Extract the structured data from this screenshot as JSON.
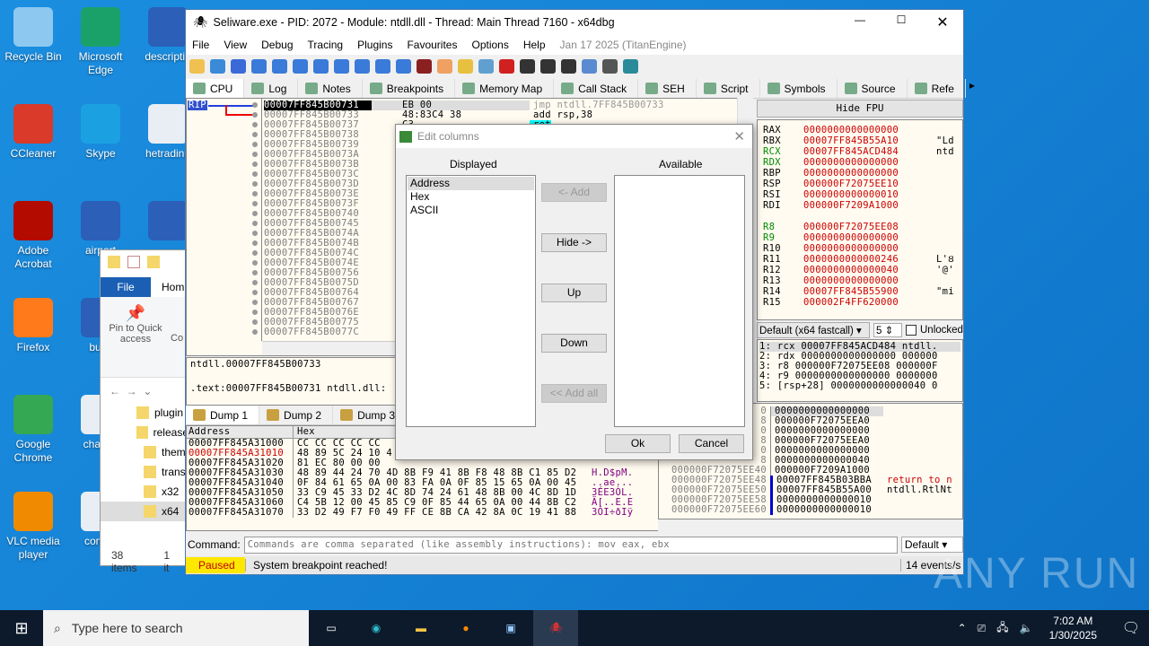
{
  "desktop": {
    "icons": [
      {
        "label": "Recycle Bin",
        "icon": "recycle-bin-icon",
        "color": "#8cc8f0"
      },
      {
        "label": "Microsoft Edge",
        "icon": "edge-icon",
        "color": "#1aa16a"
      },
      {
        "label": "descriptio",
        "icon": "word-doc-icon",
        "color": "#2b5fb8"
      },
      {
        "label": "CCleaner",
        "icon": "ccleaner-icon",
        "color": "#d93a2a"
      },
      {
        "label": "Skype",
        "icon": "skype-icon",
        "color": "#1ba1e2"
      },
      {
        "label": "hetrading",
        "icon": "image-file-icon",
        "color": "#e8eef4"
      },
      {
        "label": "Adobe Acrobat",
        "icon": "acrobat-icon",
        "color": "#b30b00"
      },
      {
        "label": "airport",
        "icon": "word-doc-icon",
        "color": "#2b5fb8"
      },
      {
        "label": "",
        "icon": "word-doc-icon",
        "color": "#2b5fb8"
      },
      {
        "label": "Firefox",
        "icon": "firefox-icon",
        "color": "#ff7a1a"
      },
      {
        "label": "build",
        "icon": "word-doc-icon",
        "color": "#2b5fb8"
      },
      {
        "label": "Google Chrome",
        "icon": "chrome-icon",
        "color": "#34a853"
      },
      {
        "label": "chance",
        "icon": "image-file-icon",
        "color": "#e8eef4"
      },
      {
        "label": "VLC media player",
        "icon": "vlc-icon",
        "color": "#f08a00"
      },
      {
        "label": "comep",
        "icon": "image-file-icon",
        "color": "#e8eef4"
      }
    ]
  },
  "explorer": {
    "file_tab": "File",
    "home_tab": "Hom",
    "pin_label": "Pin to Quick access",
    "copy_label": "Co",
    "folders": [
      "plugin",
      "release",
      "them",
      "trans",
      "x32",
      "x64"
    ],
    "status_items": "38 items",
    "status_sel": "1 it"
  },
  "debugger": {
    "title": "Seliware.exe - PID: 2072 - Module: ntdll.dll - Thread: Main Thread 7160 - x64dbg",
    "menu": [
      "File",
      "View",
      "Debug",
      "Tracing",
      "Plugins",
      "Favourites",
      "Options",
      "Help"
    ],
    "build": "Jan 17 2025 (TitanEngine)",
    "tabs": [
      "CPU",
      "Log",
      "Notes",
      "Breakpoints",
      "Memory Map",
      "Call Stack",
      "SEH",
      "Script",
      "Symbols",
      "Source",
      "Refe"
    ],
    "rip_label": "RIP",
    "disasm_addresses": [
      "00007FF845B00731",
      "00007FF845B00733",
      "00007FF845B00737",
      "00007FF845B00738",
      "00007FF845B00739",
      "00007FF845B0073A",
      "00007FF845B0073B",
      "00007FF845B0073C",
      "00007FF845B0073D",
      "00007FF845B0073E",
      "00007FF845B0073F",
      "00007FF845B00740",
      "00007FF845B00745",
      "00007FF845B0074A",
      "00007FF845B0074B",
      "00007FF845B0074C",
      "00007FF845B0074E",
      "00007FF845B00756",
      "00007FF845B0075D",
      "00007FF845B00764",
      "00007FF845B00767",
      "00007FF845B0076E",
      "00007FF845B00775",
      "00007FF845B0077C"
    ],
    "disasm_bytes": [
      "EB 00",
      "48:83C4 38",
      "C3"
    ],
    "disasm_instr": [
      "jmp ntdll.7FF845B00733",
      "add rsp,38",
      "ret"
    ],
    "info_line1": "ntdll.00007FF845B00733",
    "info_line2": ".text:00007FF845B00731 ntdll.dll:",
    "hide_fpu": "Hide FPU",
    "registers": [
      {
        "name": "RAX",
        "value": "0000000000000000",
        "comment": "",
        "green": false
      },
      {
        "name": "RBX",
        "value": "00007FF845B55A10",
        "comment": "\"Ld",
        "green": false
      },
      {
        "name": "RCX",
        "value": "00007FF845ACD484",
        "comment": "ntd",
        "green": true
      },
      {
        "name": "RDX",
        "value": "0000000000000000",
        "comment": "",
        "green": true
      },
      {
        "name": "RBP",
        "value": "0000000000000000",
        "comment": "",
        "green": false
      },
      {
        "name": "RSP",
        "value": "000000F72075EE10",
        "comment": "",
        "green": false
      },
      {
        "name": "RSI",
        "value": "0000000000000010",
        "comment": "",
        "green": false
      },
      {
        "name": "RDI",
        "value": "000000F7209A1000",
        "comment": "",
        "green": false
      },
      {
        "name": "",
        "value": "",
        "comment": "",
        "green": false
      },
      {
        "name": "R8",
        "value": "000000F72075EE08",
        "comment": "",
        "green": true
      },
      {
        "name": "R9",
        "value": "0000000000000000",
        "comment": "",
        "green": true
      },
      {
        "name": "R10",
        "value": "0000000000000000",
        "comment": "",
        "green": false
      },
      {
        "name": "R11",
        "value": "0000000000000246",
        "comment": "L'Ȣ",
        "green": false
      },
      {
        "name": "R12",
        "value": "0000000000000040",
        "comment": "'@'",
        "green": false
      },
      {
        "name": "R13",
        "value": "0000000000000000",
        "comment": "",
        "green": false
      },
      {
        "name": "R14",
        "value": "00007FF845B55900",
        "comment": "\"mi",
        "green": false
      },
      {
        "name": "R15",
        "value": "000002F4FF620000",
        "comment": "",
        "green": false
      }
    ],
    "callconv": "Default (x64 fastcall)",
    "argcount": "5",
    "unlocked": "Unlocked",
    "args": [
      "1: rcx 00007FF845ACD484 ntdll.",
      "2: rdx 0000000000000000 000000",
      "3: r8 000000F72075EE08 000000F",
      "4: r9 0000000000000000 0000000",
      "5: [rsp+28] 0000000000000040 0"
    ],
    "dump_tabs": [
      "Dump 1",
      "Dump 2",
      "Dump 3"
    ],
    "dump_headers": [
      "Address",
      "Hex"
    ],
    "dump_rows": [
      {
        "addr": "00007FF845A31000",
        "hex": "CC CC CC CC CC",
        "ascii": ""
      },
      {
        "addr": "00007FF845A31010",
        "hex": "48 89 5C 24 10 4",
        "ascii": ""
      },
      {
        "addr": "00007FF845A31020",
        "hex": "81 EC 80 00 00",
        "ascii": ""
      },
      {
        "addr": "00007FF845A31030",
        "hex": "48 89 44 24 70 4D 8B F9 41 8B F8 48 8B C1 85 D2",
        "ascii": "H.D$pM."
      },
      {
        "addr": "00007FF845A31040",
        "hex": "0F 84 61 65 0A 00 83 FA 0A 0F 85 15 65 0A 00 45",
        "ascii": "..ae..."
      },
      {
        "addr": "00007FF845A31050",
        "hex": "33 C9 45 33 D2 4C 8D 74 24 61 48 8B 00 4C 8D 1D",
        "ascii": "3ÉE3ÒL."
      },
      {
        "addr": "00007FF845A31060",
        "hex": "C4 5B 12 00 45 85 C9 0F 85 44 65 0A 00 44 8B C2",
        "ascii": "Ä[..E.E"
      },
      {
        "addr": "00007FF845A31070",
        "hex": "33 D2 49 F7 F0 49 FF CE 8B CA 42 8A 0C 19 41 88",
        "ascii": "3ÒI÷ðIÿ"
      }
    ],
    "stack_rows": [
      {
        "addr": "0",
        "val": "0000000000000000",
        "comment": ""
      },
      {
        "addr": "8",
        "val": "000000F72075EEA0",
        "comment": ""
      },
      {
        "addr": "0",
        "val": "0000000000000000",
        "comment": ""
      },
      {
        "addr": "8",
        "val": "000000F72075EEA0",
        "comment": ""
      },
      {
        "addr": "0",
        "val": "0000000000000000",
        "comment": ""
      },
      {
        "addr": "8",
        "val": "0000000000000040",
        "comment": ""
      },
      {
        "addr": "000000F72075EE40",
        "val": "000000F7209A1000",
        "comment": ""
      },
      {
        "addr": "000000F72075EE48",
        "val": "00007FF845B03BBA",
        "comment": "return to n"
      },
      {
        "addr": "000000F72075EE50",
        "val": "00007FF845B55A00",
        "comment": "ntdll.RtlNt"
      },
      {
        "addr": "000000F72075EE58",
        "val": "0000000000000010",
        "comment": ""
      },
      {
        "addr": "000000F72075EE60",
        "val": "0000000000000010",
        "comment": ""
      }
    ],
    "command_label": "Command:",
    "command_placeholder": "Commands are comma separated (like assembly instructions): mov eax, ebx",
    "command_mode": "Default",
    "status": "Paused",
    "status_msg": "System breakpoint reached!",
    "events": "14 events/s"
  },
  "dialog": {
    "title": "Edit columns",
    "displayed_label": "Displayed",
    "available_label": "Available",
    "displayed": [
      "Address",
      "Hex",
      "ASCII"
    ],
    "add": "<- Add",
    "hide": "Hide ->",
    "up": "Up",
    "down": "Down",
    "add_all": "<< Add all",
    "ok": "Ok",
    "cancel": "Cancel"
  },
  "taskbar": {
    "search": "Type here to search",
    "time": "7:02 AM",
    "date": "1/30/2025"
  },
  "watermark": "ANY RUN"
}
